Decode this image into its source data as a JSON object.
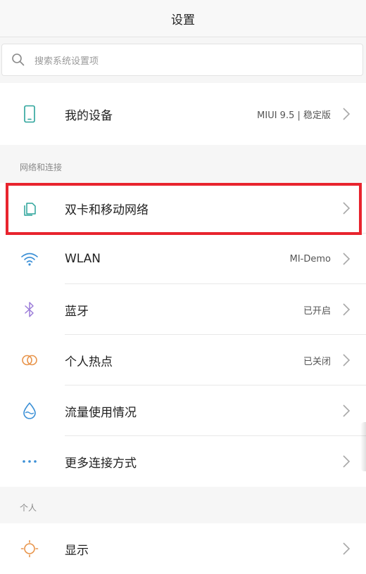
{
  "header": {
    "title": "设置"
  },
  "search": {
    "placeholder": "搜索系统设置项"
  },
  "my_device": {
    "label": "我的设备",
    "value": "MIUI 9.5 | 稳定版"
  },
  "sections": {
    "network": {
      "title": "网络和连接"
    },
    "personal": {
      "title": "个人"
    }
  },
  "network_items": [
    {
      "label": "双卡和移动网络",
      "value": "",
      "icon": "sim-cards-icon"
    },
    {
      "label": "WLAN",
      "value": "MI-Demo",
      "icon": "wifi-icon"
    },
    {
      "label": "蓝牙",
      "value": "已开启",
      "icon": "bluetooth-icon"
    },
    {
      "label": "个人热点",
      "value": "已关闭",
      "icon": "hotspot-icon"
    },
    {
      "label": "流量使用情况",
      "value": "",
      "icon": "data-usage-icon"
    },
    {
      "label": "更多连接方式",
      "value": "",
      "icon": "more-icon"
    }
  ],
  "personal_items": [
    {
      "label": "显示",
      "value": "",
      "icon": "display-icon"
    }
  ],
  "colors": {
    "highlight": "#e8242e",
    "icon_teal": "#2aa39a",
    "icon_blue": "#3a8fd6",
    "icon_purple": "#9b7cd8",
    "icon_orange": "#e8944a"
  }
}
